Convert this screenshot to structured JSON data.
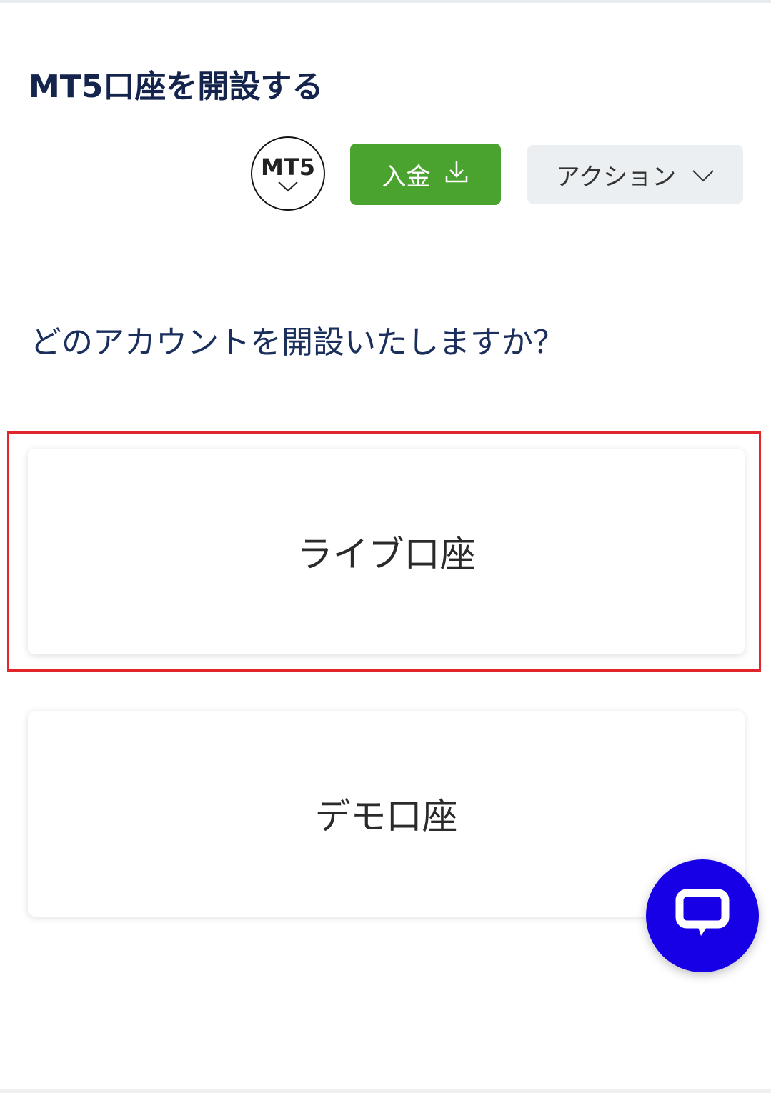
{
  "header": {
    "title": "MT5口座を開設する"
  },
  "toolbar": {
    "platform_badge": "MT5",
    "deposit_label": "入金",
    "action_label": "アクション"
  },
  "main": {
    "question": "どのアカウントを開設いたしますか？",
    "options": [
      {
        "label": "ライブ口座",
        "highlighted": true
      },
      {
        "label": "デモ口座",
        "highlighted": false
      }
    ]
  },
  "colors": {
    "title": "#14244d",
    "deposit_button": "#4aa32e",
    "action_button": "#eceff1",
    "highlight_border": "#e0252b",
    "chat_button": "#1800e6"
  },
  "icons": {
    "badge_chevron": "chevron-down-icon",
    "deposit": "download-icon",
    "action_chevron": "chevron-down-icon",
    "chat": "chat-bubble-icon"
  }
}
